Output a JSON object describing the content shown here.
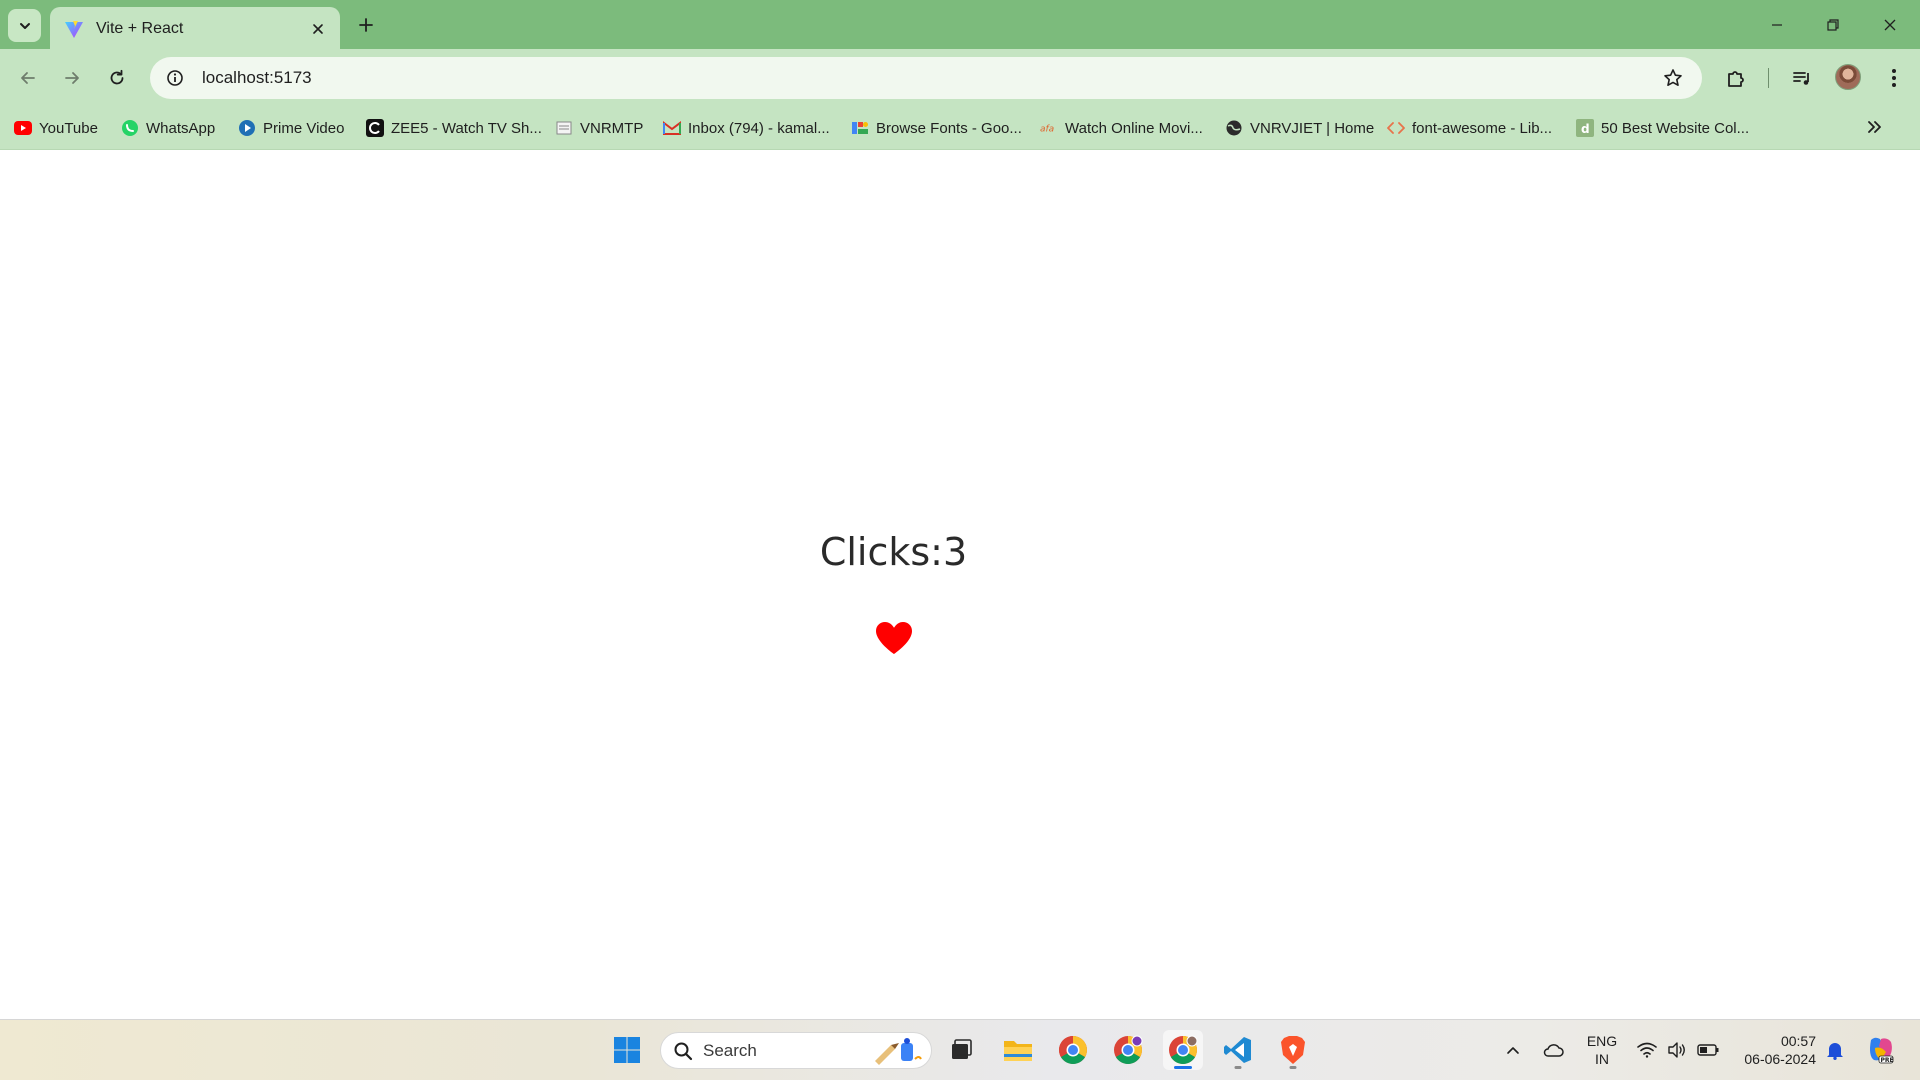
{
  "browser": {
    "tab": {
      "title": "Vite + React"
    },
    "address_bar": {
      "url": "localhost:5173"
    },
    "bookmarks": [
      {
        "label": "YouTube",
        "icon": "youtube-icon"
      },
      {
        "label": "WhatsApp",
        "icon": "whatsapp-icon"
      },
      {
        "label": "Prime Video",
        "icon": "prime-video-icon"
      },
      {
        "label": "ZEE5 - Watch TV Sh...",
        "icon": "zee5-icon"
      },
      {
        "label": "VNRMTP",
        "icon": "vnrmtp-icon"
      },
      {
        "label": "Inbox (794) - kamal...",
        "icon": "gmail-icon"
      },
      {
        "label": "Browse Fonts - Goo...",
        "icon": "google-fonts-icon"
      },
      {
        "label": "Watch Online Movi...",
        "icon": "movies-icon"
      },
      {
        "label": "VNRVJIET | Home",
        "icon": "globe-icon"
      },
      {
        "label": "font-awesome - Lib...",
        "icon": "code-icon"
      },
      {
        "label": "50 Best Website Col...",
        "icon": "website-icon"
      }
    ]
  },
  "app": {
    "clicks_text": "Clicks:3",
    "heart_icon": "heart-icon",
    "heart_color": "#ff0000"
  },
  "taskbar": {
    "search_label": "Search",
    "language": {
      "line1": "ENG",
      "line2": "IN"
    },
    "clock": {
      "time": "00:57",
      "date": "06-06-2024"
    }
  },
  "colors": {
    "tabstrip": "#7cbb7c",
    "toolbar": "#c5e4c2",
    "accent": "#1a73e8"
  }
}
